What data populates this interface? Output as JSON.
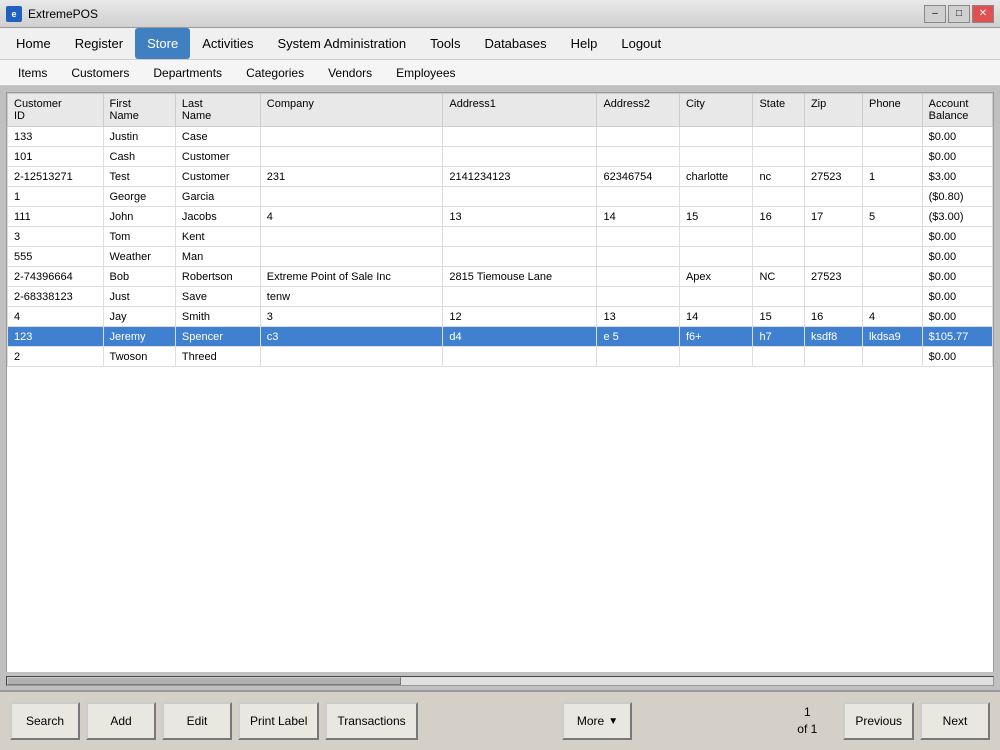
{
  "window": {
    "title": "ExtremePOS",
    "icon": "e"
  },
  "menu": {
    "items": [
      {
        "id": "home",
        "label": "Home"
      },
      {
        "id": "register",
        "label": "Register"
      },
      {
        "id": "store",
        "label": "Store",
        "active": true
      },
      {
        "id": "activities",
        "label": "Activities"
      },
      {
        "id": "system-admin",
        "label": "System Administration"
      },
      {
        "id": "tools",
        "label": "Tools"
      },
      {
        "id": "databases",
        "label": "Databases"
      },
      {
        "id": "help",
        "label": "Help"
      },
      {
        "id": "logout",
        "label": "Logout"
      }
    ]
  },
  "submenu": {
    "items": [
      {
        "id": "items",
        "label": "Items"
      },
      {
        "id": "customers",
        "label": "Customers"
      },
      {
        "id": "departments",
        "label": "Departments"
      },
      {
        "id": "categories",
        "label": "Categories"
      },
      {
        "id": "vendors",
        "label": "Vendors"
      },
      {
        "id": "employees",
        "label": "Employees"
      }
    ]
  },
  "table": {
    "columns": [
      {
        "id": "customer-id",
        "label": "Customer\nID"
      },
      {
        "id": "first-name",
        "label": "First\nName"
      },
      {
        "id": "last-name",
        "label": "Last\nName"
      },
      {
        "id": "company",
        "label": "Company"
      },
      {
        "id": "address1",
        "label": "Address1"
      },
      {
        "id": "address2",
        "label": "Address2"
      },
      {
        "id": "city",
        "label": "City"
      },
      {
        "id": "state",
        "label": "State"
      },
      {
        "id": "zip",
        "label": "Zip"
      },
      {
        "id": "phone",
        "label": "Phone"
      },
      {
        "id": "account-balance",
        "label": "Account\nBalance"
      }
    ],
    "rows": [
      {
        "id": 0,
        "customer_id": "133",
        "first_name": "Justin",
        "last_name": "Case",
        "company": "",
        "address1": "",
        "address2": "",
        "city": "",
        "state": "",
        "zip": "",
        "phone": "",
        "account_balance": "$0.00",
        "selected": false
      },
      {
        "id": 1,
        "customer_id": "101",
        "first_name": "Cash",
        "last_name": "Customer",
        "company": "",
        "address1": "",
        "address2": "",
        "city": "",
        "state": "",
        "zip": "",
        "phone": "",
        "account_balance": "$0.00",
        "selected": false
      },
      {
        "id": 2,
        "customer_id": "2-12513271",
        "first_name": "Test",
        "last_name": "Customer",
        "company": "231",
        "address1": "2141234123",
        "address2": "62346754",
        "city": "charlotte",
        "state": "nc",
        "zip": "27523",
        "phone": "1",
        "account_balance": "$3.00",
        "selected": false
      },
      {
        "id": 3,
        "customer_id": "1",
        "first_name": "George",
        "last_name": "Garcia",
        "company": "",
        "address1": "",
        "address2": "",
        "city": "",
        "state": "",
        "zip": "",
        "phone": "",
        "account_balance": "($0.80)",
        "selected": false
      },
      {
        "id": 4,
        "customer_id": "111",
        "first_name": "John",
        "last_name": "Jacobs",
        "company": "4",
        "address1": "13",
        "address2": "14",
        "city": "15",
        "state": "16",
        "zip": "17",
        "phone": "5",
        "account_balance": "($3.00)",
        "selected": false
      },
      {
        "id": 5,
        "customer_id": "3",
        "first_name": "Tom",
        "last_name": "Kent",
        "company": "",
        "address1": "",
        "address2": "",
        "city": "",
        "state": "",
        "zip": "",
        "phone": "",
        "account_balance": "$0.00",
        "selected": false
      },
      {
        "id": 6,
        "customer_id": "555",
        "first_name": "Weather",
        "last_name": "Man",
        "company": "",
        "address1": "",
        "address2": "",
        "city": "",
        "state": "",
        "zip": "",
        "phone": "",
        "account_balance": "$0.00",
        "selected": false
      },
      {
        "id": 7,
        "customer_id": "2-74396664",
        "first_name": "Bob",
        "last_name": "Robertson",
        "company": "Extreme Point of Sale Inc",
        "address1": "2815 Tiemouse Lane",
        "address2": "",
        "city": "Apex",
        "state": "NC",
        "zip": "27523",
        "phone": "",
        "account_balance": "$0.00",
        "selected": false
      },
      {
        "id": 8,
        "customer_id": "2-68338123",
        "first_name": "Just",
        "last_name": "Save",
        "company": "tenw",
        "address1": "",
        "address2": "",
        "city": "",
        "state": "",
        "zip": "",
        "phone": "",
        "account_balance": "$0.00",
        "selected": false
      },
      {
        "id": 9,
        "customer_id": "4",
        "first_name": "Jay",
        "last_name": "Smith",
        "company": "3",
        "address1": "12",
        "address2": "13",
        "city": "14",
        "state": "15",
        "zip": "16",
        "phone": "4",
        "account_balance": "$0.00",
        "selected": false
      },
      {
        "id": 10,
        "customer_id": "123",
        "first_name": "Jeremy",
        "last_name": "Spencer",
        "company": "c3",
        "address1": "d4",
        "address2": "e 5",
        "city": "f6+",
        "state": "h7",
        "zip": "ksdf8",
        "phone": "lkdsa9",
        "account_balance": "$105.77",
        "selected": true
      },
      {
        "id": 11,
        "customer_id": "2",
        "first_name": "Twoson",
        "last_name": "Threed",
        "company": "",
        "address1": "",
        "address2": "",
        "city": "",
        "state": "",
        "zip": "",
        "phone": "",
        "account_balance": "$0.00",
        "selected": false
      }
    ]
  },
  "buttons": {
    "search": "Search",
    "add": "Add",
    "edit": "Edit",
    "print_label": "Print Label",
    "transactions": "Transactions",
    "more": "More",
    "previous": "Previous",
    "next": "Next"
  },
  "pagination": {
    "current": "1",
    "total": "1",
    "label": "of"
  }
}
